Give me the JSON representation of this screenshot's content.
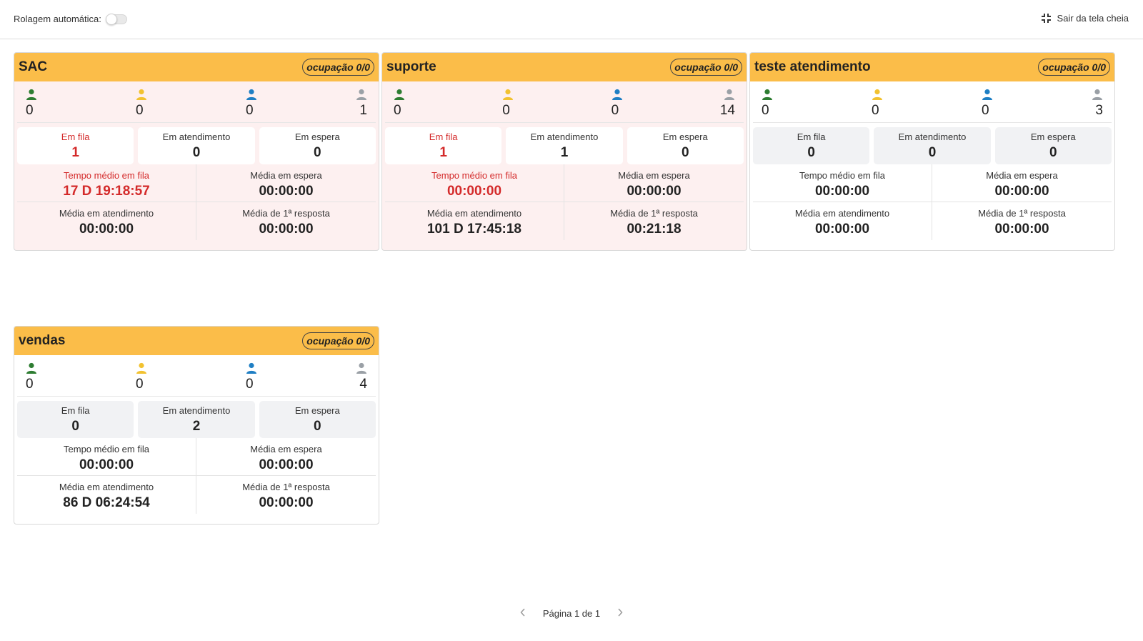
{
  "topbar": {
    "auto_scroll_label": "Rolagem automática:",
    "exit_fullscreen_label": "Sair da tela cheia"
  },
  "colors": {
    "header_bg": "#fbbd49",
    "alert_bg": "#fdf0f0",
    "alert_text": "#d42a2a",
    "agent_online": "#2e7d32",
    "agent_pause": "#f2c230",
    "agent_busy": "#1f7fc4",
    "agent_offline": "#9aa0a6"
  },
  "queues": [
    {
      "name": "SAC",
      "occupancy": "ocupação 0/0",
      "agents": [
        "0",
        "0",
        "0",
        "1"
      ],
      "boxes": [
        {
          "label": "Em fila",
          "value": "1"
        },
        {
          "label": "Em atendimento",
          "value": "0"
        },
        {
          "label": "Em espera",
          "value": "0"
        }
      ],
      "stats": [
        {
          "label": "Tempo médio em fila",
          "value": "17 D 19:18:57"
        },
        {
          "label": "Média em espera",
          "value": "00:00:00"
        },
        {
          "label": "Média em atendimento",
          "value": "00:00:00"
        },
        {
          "label": "Média de 1ª resposta",
          "value": "00:00:00"
        }
      ]
    },
    {
      "name": "suporte",
      "occupancy": "ocupação 0/0",
      "agents": [
        "0",
        "0",
        "0",
        "14"
      ],
      "boxes": [
        {
          "label": "Em fila",
          "value": "1"
        },
        {
          "label": "Em atendimento",
          "value": "1"
        },
        {
          "label": "Em espera",
          "value": "0"
        }
      ],
      "stats": [
        {
          "label": "Tempo médio em fila",
          "value": "00:00:00"
        },
        {
          "label": "Média em espera",
          "value": "00:00:00"
        },
        {
          "label": "Média em atendimento",
          "value": "101 D 17:45:18"
        },
        {
          "label": "Média de 1ª resposta",
          "value": "00:21:18"
        }
      ]
    },
    {
      "name": "teste atendimento",
      "occupancy": "ocupação 0/0",
      "agents": [
        "0",
        "0",
        "0",
        "3"
      ],
      "boxes": [
        {
          "label": "Em fila",
          "value": "0"
        },
        {
          "label": "Em atendimento",
          "value": "0"
        },
        {
          "label": "Em espera",
          "value": "0"
        }
      ],
      "stats": [
        {
          "label": "Tempo médio em fila",
          "value": "00:00:00"
        },
        {
          "label": "Média em espera",
          "value": "00:00:00"
        },
        {
          "label": "Média em atendimento",
          "value": "00:00:00"
        },
        {
          "label": "Média de 1ª resposta",
          "value": "00:00:00"
        }
      ]
    },
    {
      "name": "vendas",
      "occupancy": "ocupação 0/0",
      "agents": [
        "0",
        "0",
        "0",
        "4"
      ],
      "boxes": [
        {
          "label": "Em fila",
          "value": "0"
        },
        {
          "label": "Em atendimento",
          "value": "2"
        },
        {
          "label": "Em espera",
          "value": "0"
        }
      ],
      "stats": [
        {
          "label": "Tempo médio em fila",
          "value": "00:00:00"
        },
        {
          "label": "Média em espera",
          "value": "00:00:00"
        },
        {
          "label": "Média em atendimento",
          "value": "86 D 06:24:54"
        },
        {
          "label": "Média de 1ª resposta",
          "value": "00:00:00"
        }
      ]
    }
  ],
  "pagination": {
    "text": "Página 1 de 1"
  }
}
